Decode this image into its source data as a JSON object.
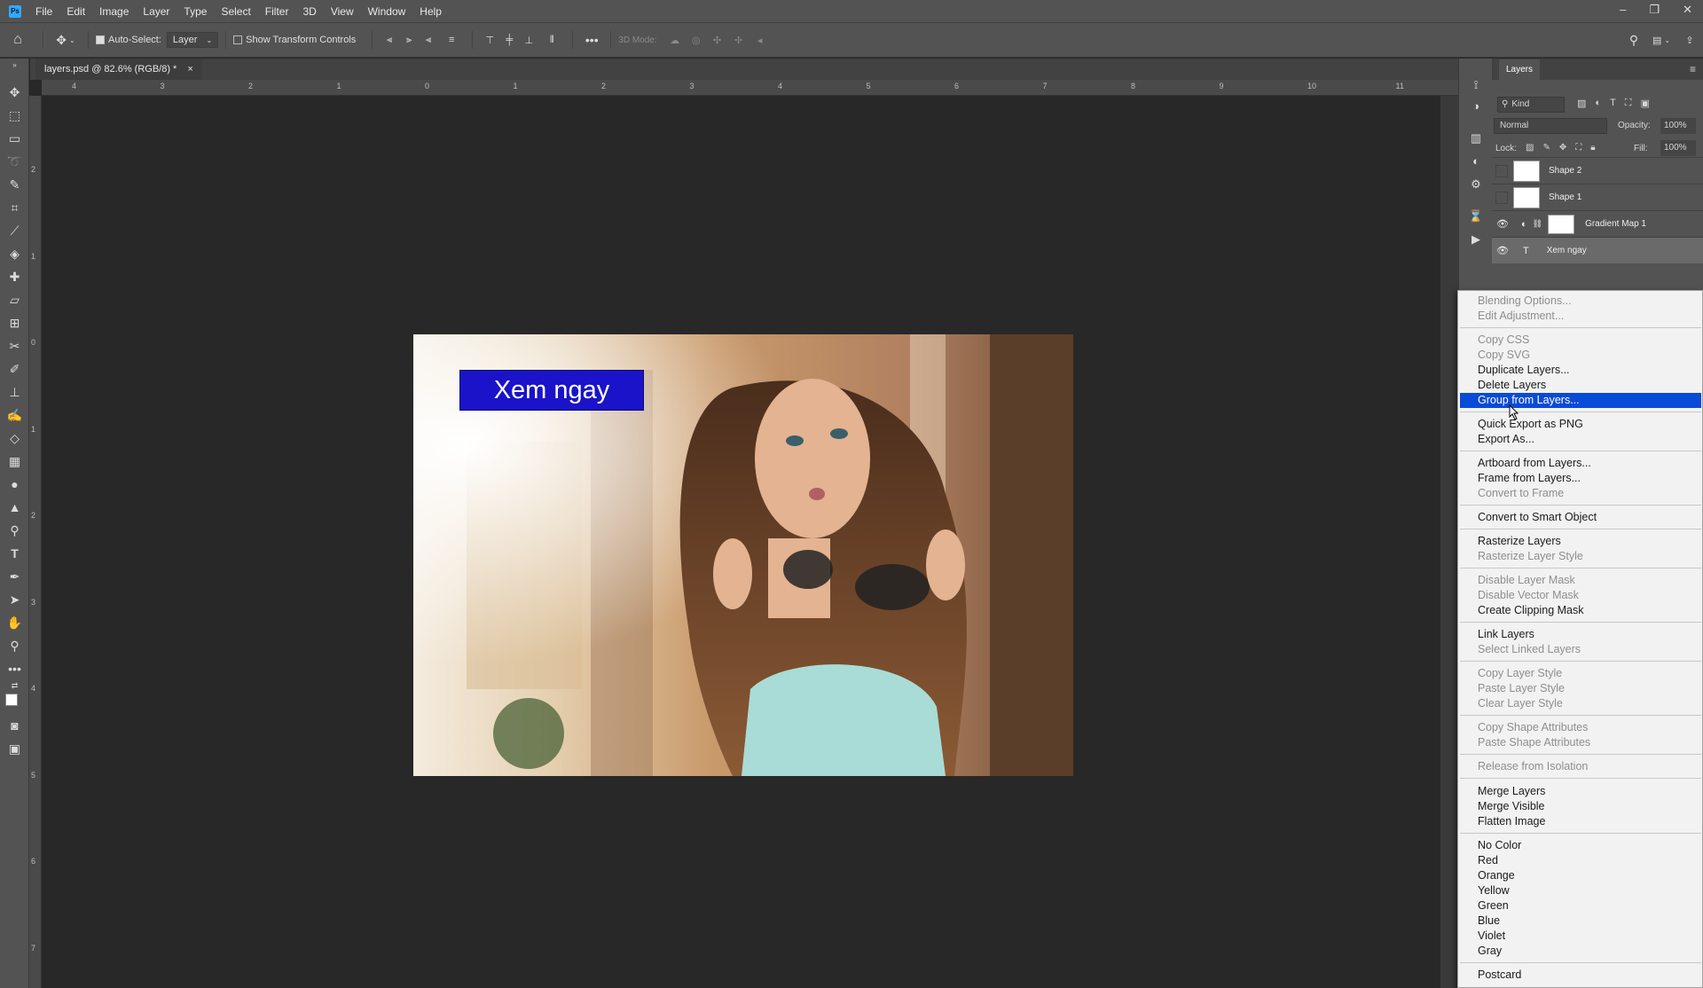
{
  "app": {
    "logo": "Ps"
  },
  "menu": [
    "File",
    "Edit",
    "Image",
    "Layer",
    "Type",
    "Select",
    "Filter",
    "3D",
    "View",
    "Window",
    "Help"
  ],
  "options_bar": {
    "auto_select_label": "Auto-Select:",
    "auto_select_checked": true,
    "auto_select_target": "Layer",
    "show_transform_label": "Show Transform Controls",
    "mode_3d_label": "3D Mode:"
  },
  "document": {
    "tab_title": "layers.psd @ 82.6% (RGB/8) *",
    "banner_text": "Xem ngay",
    "banner_color": "#1a13c9"
  },
  "rulers": {
    "top": [
      "4",
      "3",
      "2",
      "1",
      "0",
      "1",
      "2",
      "3",
      "4",
      "5",
      "6",
      "7",
      "8",
      "9",
      "10",
      "11"
    ],
    "left": [
      "2",
      "1",
      "0",
      "1",
      "2",
      "3",
      "4",
      "5",
      "6",
      "7"
    ]
  },
  "layers_panel": {
    "tab": "Layers",
    "filter_kind": "Kind",
    "blend_mode": "Normal",
    "opacity_label": "Opacity:",
    "opacity_value": "100%",
    "lock_label": "Lock:",
    "fill_label": "Fill:",
    "fill_value": "100%",
    "layers": [
      {
        "name": "Shape 2",
        "visible": false
      },
      {
        "name": "Shape 1",
        "visible": false
      },
      {
        "name": "Gradient Map 1",
        "visible": true
      },
      {
        "name": "Xem ngay",
        "visible": true
      }
    ]
  },
  "context_menu": {
    "items": [
      {
        "label": "Blending Options...",
        "disabled": true
      },
      {
        "label": "Edit Adjustment...",
        "disabled": true
      },
      {
        "label": "Copy CSS",
        "disabled": true
      },
      {
        "label": "Copy SVG",
        "disabled": true
      },
      {
        "label": "Duplicate Layers...",
        "disabled": false
      },
      {
        "label": "Delete Layers",
        "disabled": false
      },
      {
        "label": "Group from Layers...",
        "disabled": false,
        "highlighted": true
      },
      {
        "label": "Quick Export as PNG",
        "disabled": false
      },
      {
        "label": "Export As...",
        "disabled": false
      },
      {
        "label": "Artboard from Layers...",
        "disabled": false
      },
      {
        "label": "Frame from Layers...",
        "disabled": false
      },
      {
        "label": "Convert to Frame",
        "disabled": true
      },
      {
        "label": "Convert to Smart Object",
        "disabled": false
      },
      {
        "label": "Rasterize Layers",
        "disabled": false
      },
      {
        "label": "Rasterize Layer Style",
        "disabled": true
      },
      {
        "label": "Disable Layer Mask",
        "disabled": true
      },
      {
        "label": "Disable Vector Mask",
        "disabled": true
      },
      {
        "label": "Create Clipping Mask",
        "disabled": false
      },
      {
        "label": "Link Layers",
        "disabled": false
      },
      {
        "label": "Select Linked Layers",
        "disabled": true
      },
      {
        "label": "Copy Layer Style",
        "disabled": true
      },
      {
        "label": "Paste Layer Style",
        "disabled": true
      },
      {
        "label": "Clear Layer Style",
        "disabled": true
      },
      {
        "label": "Copy Shape Attributes",
        "disabled": true
      },
      {
        "label": "Paste Shape Attributes",
        "disabled": true
      },
      {
        "label": "Release from Isolation",
        "disabled": true
      },
      {
        "label": "Merge Layers",
        "disabled": false
      },
      {
        "label": "Merge Visible",
        "disabled": false
      },
      {
        "label": "Flatten Image",
        "disabled": false
      },
      {
        "label": "No Color",
        "disabled": false
      },
      {
        "label": "Red",
        "disabled": false
      },
      {
        "label": "Orange",
        "disabled": false
      },
      {
        "label": "Yellow",
        "disabled": false
      },
      {
        "label": "Green",
        "disabled": false
      },
      {
        "label": "Blue",
        "disabled": false
      },
      {
        "label": "Violet",
        "disabled": false
      },
      {
        "label": "Gray",
        "disabled": false
      },
      {
        "label": "Postcard",
        "disabled": false
      }
    ],
    "highlight_color": "#0a4ad8"
  }
}
